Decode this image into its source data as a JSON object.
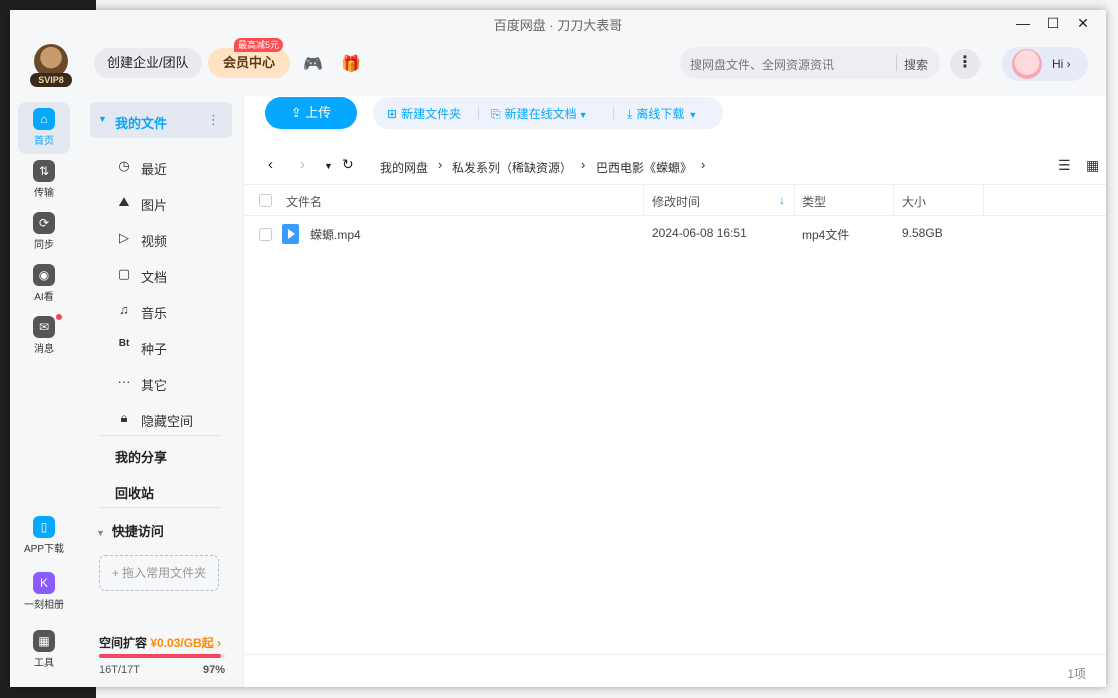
{
  "window": {
    "title": "百度网盘 · 刀刀大表哥"
  },
  "header": {
    "svip_badge": "SVIP8",
    "enterprise_label": "创建企业/团队",
    "vip_label": "会员中心",
    "vip_promo": "最高减5元",
    "search_placeholder": "搜网盘文件、全网资源资讯",
    "search_button": "搜索",
    "hi_label": "Hi ›"
  },
  "nav": {
    "items": [
      {
        "label": "首页",
        "icon": "home-icon"
      },
      {
        "label": "传输",
        "icon": "transfer-icon"
      },
      {
        "label": "同步",
        "icon": "sync-icon"
      },
      {
        "label": "AI看",
        "icon": "ai-icon"
      },
      {
        "label": "消息",
        "icon": "message-icon"
      },
      {
        "label": "APP下载",
        "icon": "phone-icon"
      },
      {
        "label": "一刻相册",
        "icon": "album-icon"
      },
      {
        "label": "工具",
        "icon": "tools-icon"
      }
    ]
  },
  "sidebar": {
    "my_files": "我的文件",
    "items": [
      {
        "label": "最近",
        "icon": "clock-icon"
      },
      {
        "label": "图片",
        "icon": "image-icon"
      },
      {
        "label": "视频",
        "icon": "play-icon"
      },
      {
        "label": "文档",
        "icon": "document-icon"
      },
      {
        "label": "音乐",
        "icon": "headphones-icon"
      },
      {
        "label": "种子",
        "icon": "bt-icon"
      },
      {
        "label": "其它",
        "icon": "ellipsis-icon"
      },
      {
        "label": "隐藏空间",
        "icon": "lock-icon"
      }
    ],
    "my_share": "我的分享",
    "recycle": "回收站",
    "quick_access": "快捷访问",
    "drop_hint": "+ 拖入常用文件夹",
    "quota_title": "空间扩容",
    "quota_price": "¥0.03/GB起",
    "quota_used": "16T/17T",
    "quota_percent": "97%",
    "quota_fraction": 0.97
  },
  "toolbar": {
    "upload": "上传",
    "new_folder": "新建文件夹",
    "new_doc": "新建在线文档",
    "offline": "离线下载"
  },
  "breadcrumb": [
    "我的网盘",
    "私发系列（稀缺资源）",
    "巴西电影《蝾螈》"
  ],
  "table": {
    "headers": [
      "文件名",
      "修改时间",
      "类型",
      "大小"
    ],
    "rows": [
      {
        "name": "蝾螈.mp4",
        "modified": "2024-06-08 16:51",
        "type": "mp4文件",
        "size": "9.58GB"
      }
    ]
  },
  "footer": {
    "count": "1项"
  },
  "colors": {
    "accent": "#06a7ff",
    "vip": "#ffe3c2",
    "warning": "#f5455c",
    "price": "#ff8a00"
  }
}
